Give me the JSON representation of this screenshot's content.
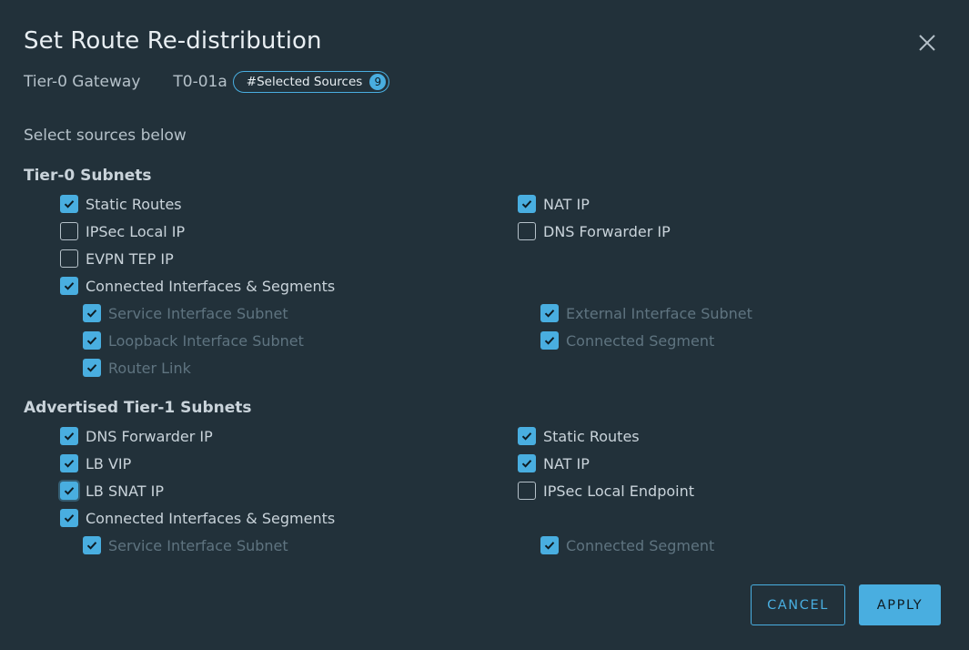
{
  "dialog": {
    "title": "Set Route Re-distribution",
    "gateway_label": "Tier-0 Gateway",
    "gateway_name": "T0-01a",
    "selected_badge_label": "#Selected Sources",
    "selected_count": "9",
    "instruction": "Select sources below"
  },
  "tier0": {
    "title": "Tier-0 Subnets",
    "items": [
      {
        "label": "Static Routes",
        "checked": true
      },
      {
        "label": "NAT IP",
        "checked": true
      },
      {
        "label": "IPSec Local IP",
        "checked": false
      },
      {
        "label": "DNS Forwarder IP",
        "checked": false
      },
      {
        "label": "EVPN TEP IP",
        "checked": false
      },
      {
        "label": "Connected Interfaces & Segments",
        "checked": true
      },
      {
        "label": "Service Interface Subnet",
        "checked": true
      },
      {
        "label": "External Interface Subnet",
        "checked": true
      },
      {
        "label": "Loopback Interface Subnet",
        "checked": true
      },
      {
        "label": "Connected Segment",
        "checked": true
      },
      {
        "label": "Router Link",
        "checked": true
      }
    ]
  },
  "tier1": {
    "title": "Advertised Tier-1 Subnets",
    "items": [
      {
        "label": "DNS Forwarder IP",
        "checked": true
      },
      {
        "label": "Static Routes",
        "checked": true
      },
      {
        "label": "LB VIP",
        "checked": true
      },
      {
        "label": "NAT IP",
        "checked": true
      },
      {
        "label": "LB SNAT IP",
        "checked": true
      },
      {
        "label": "IPSec Local Endpoint",
        "checked": false
      },
      {
        "label": "Connected Interfaces & Segments",
        "checked": true
      },
      {
        "label": "Service Interface Subnet",
        "checked": true
      },
      {
        "label": "Connected Segment",
        "checked": true
      }
    ]
  },
  "buttons": {
    "cancel": "CANCEL",
    "apply": "APPLY"
  },
  "colors": {
    "background": "#22313a",
    "accent": "#49aee0",
    "text": "#c9d3da",
    "disabled_text": "#5f7480"
  },
  "icons": {
    "close": "close-icon",
    "check": "checkmark-icon"
  }
}
